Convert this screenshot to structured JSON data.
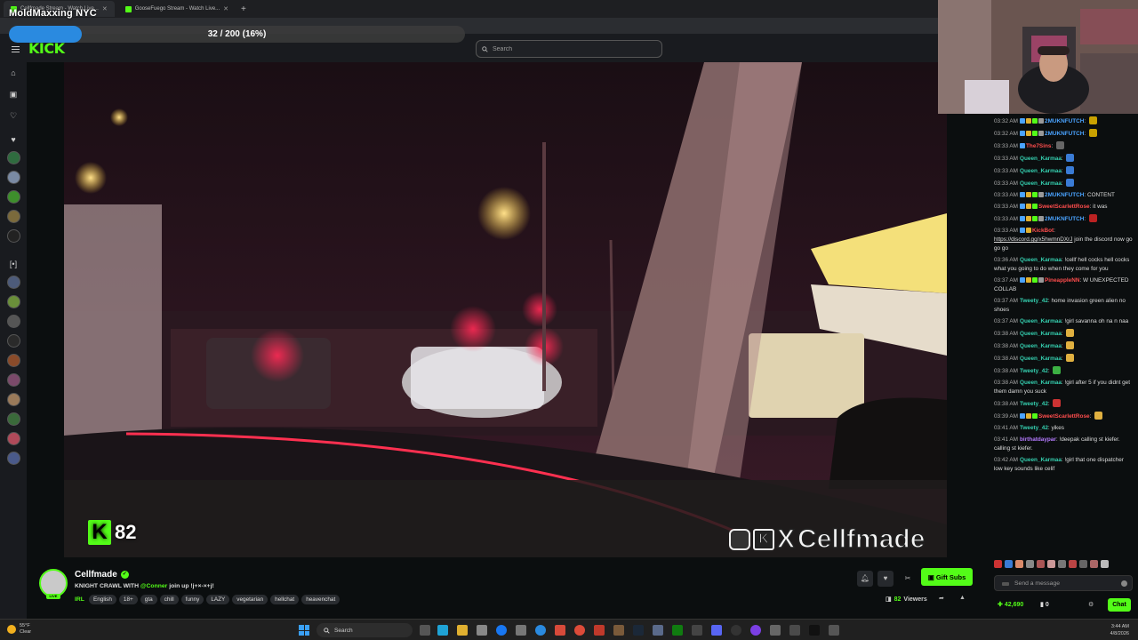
{
  "browser": {
    "tabs": [
      {
        "label": "Cellfmade Stream - Watch Live..."
      },
      {
        "label": "GooseFuego Stream - Watch Live..."
      }
    ]
  },
  "overlay": {
    "title": "MoldMaxxing NYC",
    "progress_label": "32 / 200 (16%)",
    "progress_fraction": 0.16
  },
  "header": {
    "logo": "KICK",
    "search_placeholder": "Search"
  },
  "video": {
    "counter": "82",
    "brand": "Cellfmade"
  },
  "stream": {
    "streamer": "Cellfmade",
    "title_prefix": "KNIGHT CRAWL WITH ",
    "title_mention": "@Conner",
    "title_suffix": " join up !j+×-×+j!",
    "category": "IRL",
    "tags": [
      "English",
      "18+",
      "gta",
      "chill",
      "funny",
      "LAZY",
      "vegetarian",
      "hellchat",
      "heavenchat"
    ],
    "gift_label": "Gift Subs",
    "viewers_num": "82",
    "viewers_label": "Viewers"
  },
  "chat": {
    "colors": {
      "green": "#53fc18",
      "red": "#ff4d4d",
      "purple": "#b57bff",
      "brand": "#53fc18"
    },
    "messages": [
      {
        "ts": "03:32 AM",
        "user": "2MUKNFUTCH",
        "color": "#4aa3ff",
        "text": "",
        "badges": 4,
        "emote": "#c9a100"
      },
      {
        "ts": "03:32 AM",
        "user": "2MUKNFUTCH",
        "color": "#4aa3ff",
        "text": "",
        "badges": 4,
        "emote": "#c9a100"
      },
      {
        "ts": "03:33 AM",
        "user": "The7Sins",
        "color": "#ff4d4d",
        "text": "",
        "badges": 1,
        "emote": "#666"
      },
      {
        "ts": "03:33 AM",
        "user": "Queen_Karmaa",
        "color": "#35d0b0",
        "text": "",
        "badges": 0,
        "emote": "#3a7bd5"
      },
      {
        "ts": "03:33 AM",
        "user": "Queen_Karmaa",
        "color": "#35d0b0",
        "text": "",
        "badges": 0,
        "emote": "#3a7bd5"
      },
      {
        "ts": "03:33 AM",
        "user": "Queen_Karmaa",
        "color": "#35d0b0",
        "text": "",
        "badges": 0,
        "emote": "#3a7bd5"
      },
      {
        "ts": "03:33 AM",
        "user": "2MUKNFUTCH",
        "color": "#4aa3ff",
        "text": "CONTENT",
        "badges": 4,
        "emote": ""
      },
      {
        "ts": "03:33 AM",
        "user": "SweetScarlettRose",
        "color": "#ff4d4d",
        "text": "it was",
        "badges": 3,
        "emote": ""
      },
      {
        "ts": "03:33 AM",
        "user": "2MUKNFUTCH",
        "color": "#4aa3ff",
        "text": "",
        "badges": 4,
        "emote": "#b22"
      },
      {
        "ts": "03:33 AM",
        "user": "KickBot",
        "color": "#ff4d4d",
        "text": "join the discord now go go go",
        "link": "https://discord.gg/x5hwmnDXrJ",
        "badges": 2,
        "emote": ""
      },
      {
        "ts": "03:36 AM",
        "user": "Queen_Karmaa",
        "color": "#35d0b0",
        "text": "!cellf hell cocks hell cocks what you going to do when they come for you",
        "badges": 0,
        "emote": ""
      },
      {
        "ts": "03:37 AM",
        "user": "PineappleNN",
        "color": "#ff4d4d",
        "text": "W UNEXPECTED COLLAB",
        "badges": 4,
        "emote": ""
      },
      {
        "ts": "03:37 AM",
        "user": "Tweety_42",
        "color": "#35d0b0",
        "text": "home invasion green alien no shoes",
        "badges": 0,
        "emote": ""
      },
      {
        "ts": "03:37 AM",
        "user": "Queen_Karmaa",
        "color": "#35d0b0",
        "text": "!girl savanna oh na n naa",
        "badges": 0,
        "emote": ""
      },
      {
        "ts": "03:38 AM",
        "user": "Queen_Karmaa",
        "color": "#35d0b0",
        "text": "",
        "badges": 0,
        "emote": "#e0b040"
      },
      {
        "ts": "03:38 AM",
        "user": "Queen_Karmaa",
        "color": "#35d0b0",
        "text": "",
        "badges": 0,
        "emote": "#e0b040"
      },
      {
        "ts": "03:38 AM",
        "user": "Queen_Karmaa",
        "color": "#35d0b0",
        "text": "",
        "badges": 0,
        "emote": "#e0b040"
      },
      {
        "ts": "03:38 AM",
        "user": "Tweety_42",
        "color": "#35d0b0",
        "text": "",
        "badges": 0,
        "emote": "#3cb043"
      },
      {
        "ts": "03:38 AM",
        "user": "Queen_Karmaa",
        "color": "#35d0b0",
        "text": "!girl after 5 if you didnt get them damn you suck",
        "badges": 0,
        "emote": ""
      },
      {
        "ts": "03:38 AM",
        "user": "Tweety_42",
        "color": "#35d0b0",
        "text": "",
        "badges": 0,
        "emote": "#c33"
      },
      {
        "ts": "03:39 AM",
        "user": "SweetScarlettRose",
        "color": "#ff4d4d",
        "text": "",
        "badges": 3,
        "emote": "#e0b040"
      },
      {
        "ts": "03:41 AM",
        "user": "Tweety_42",
        "color": "#35d0b0",
        "text": "yikes",
        "badges": 0,
        "emote": ""
      },
      {
        "ts": "03:41 AM",
        "user": "birthatdaypar",
        "color": "#b57bff",
        "text": "!deepak calling st kiefer. calling st kiefer.",
        "badges": 0,
        "emote": ""
      },
      {
        "ts": "03:42 AM",
        "user": "Queen_Karmaa",
        "color": "#35d0b0",
        "text": "!girl that one dispatcher low key sounds like celif",
        "badges": 0,
        "emote": ""
      }
    ],
    "input_placeholder": "Send a message",
    "points": "42,690",
    "count": "0",
    "chat_label": "Chat"
  },
  "taskbar": {
    "weather_temp": "55°F",
    "weather_desc": "Clear",
    "search_label": "Search",
    "time": "3:44 AM",
    "date": "4/8/2026"
  }
}
